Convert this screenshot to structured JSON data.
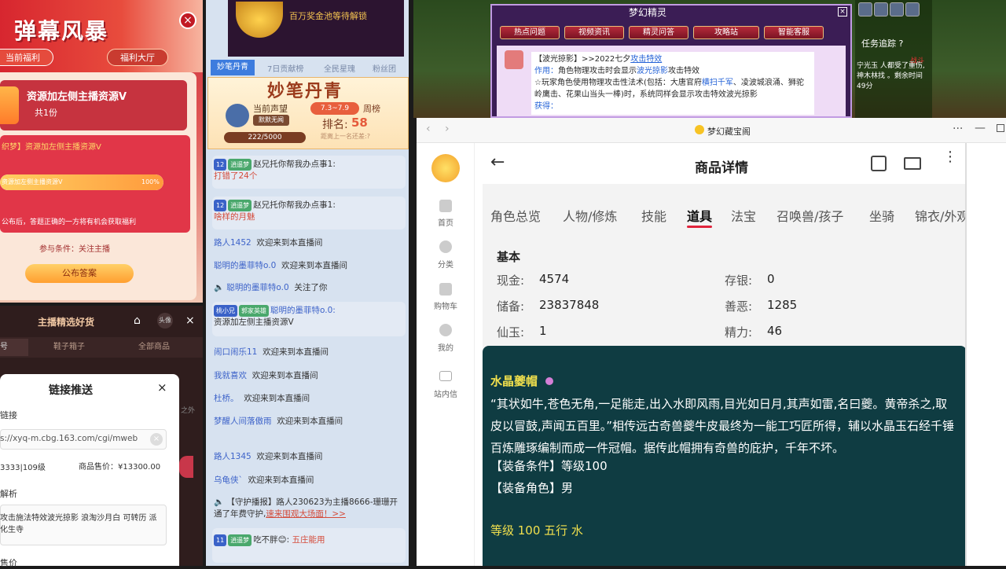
{
  "promo": {
    "title": "弹幕风暴",
    "close": "×",
    "tab_current": "当前福利",
    "tab_welfare": "福利大厅",
    "reward_name": "资源加左侧主播资源V",
    "reward_count": "共1份",
    "task_title": "织梦】资源加左侧主播资源V",
    "progress_text": "资源加左侧主播资源V",
    "progress_pct": "100%",
    "progress_value": 1.0,
    "task_note": "公布后，答题正确的一方将有机会获取福利",
    "condition": "参与条件：关注主播",
    "announce_button": "公布答案"
  },
  "shop": {
    "title": "主播精选好货",
    "home": "⌂",
    "avatar": "头像",
    "close": "×",
    "tabs": [
      "号",
      "鞋子箱子",
      "全部商品"
    ]
  },
  "dialog": {
    "title": "链接推送",
    "close": "×",
    "link_label": "链接",
    "link": "s://xyq-m.cbg.163.com/cgi/mweb",
    "clear": "×",
    "level": "3333|109级",
    "price": "商品售价：¥13300.00",
    "parse_label": "解析",
    "parse": "攻击施法特效波光掠影 浪淘沙月白 可转历 派化生寺",
    "price_label": "售价",
    "side_text": "之外"
  },
  "chat": {
    "top_text": "百万奖金池等待解锁",
    "tabs": [
      "妙笔丹青",
      "7日贡献榜",
      "全民星瑰",
      "粉丝团"
    ],
    "mb_title": "妙笔丹青",
    "voice_label": "当前声望",
    "streamer_name": "默默无闻",
    "score": "222/5000",
    "date_range": "7.3~7.9",
    "week_label": "周榜",
    "rank_label": "排名:",
    "rank": "58",
    "gap": "距离上一名还差:?",
    "messages": [
      {
        "badge": "12",
        "badge2": "逍遥梦",
        "text": "赵兄托你帮我办点事1:",
        "extra": "打错了24个",
        "extra_red": true
      },
      {
        "badge": "12",
        "badge2": "逍遥梦",
        "text": "赵兄托你帮我办点事1:",
        "extra": "啥样的月魅",
        "extra_red": true
      },
      {
        "nick": "路人1452",
        "text": "欢迎来到本直播间"
      },
      {
        "nick": "聪明的墨菲特o.0",
        "text": "欢迎来到本直播间"
      },
      {
        "nick": "聪明的墨菲特o.0",
        "text": "关注了你"
      },
      {
        "nick": "聪明的墨菲特o.0:",
        "badge": "桃小兄",
        "badge2": "郭家英雄",
        "text": "资源加左侧主播资源V"
      },
      {
        "nick": "闹口闹乐11",
        "text": "欢迎来到本直播间"
      },
      {
        "nick": "我就喜欢",
        "text": "欢迎来到本直播间"
      },
      {
        "nick": "杜桥。",
        "text": "欢迎来到本直播间"
      },
      {
        "nick": "梦醒人间落傲雨",
        "text": "欢迎来到本直播间"
      },
      {
        "nick": "路人1345",
        "text": "欢迎来到本直播间"
      },
      {
        "nick": "乌龟侠`",
        "text": "欢迎来到本直播间"
      },
      {
        "nick": "【守护播报】",
        "text": "路人230623为主播8666-珊珊开通了年费守护,",
        "link": "速来围观大场面！>>"
      },
      {
        "badge": "11",
        "badge2": "逍遥梦",
        "text": "吃不胖😊:",
        "extra": "五庄能用",
        "extra_red": true
      }
    ]
  },
  "game": {
    "mj_title": "梦幻精灵",
    "mj_close": "×",
    "buttons": [
      "热点问题",
      "视频资讯",
      "精灵问答",
      "攻略站",
      "智能客服"
    ],
    "content_1": "【波光掠影】>>2022七夕",
    "content_1_link": "攻击特效",
    "content_2_label": "作用：",
    "content_2": "角色物理攻击时会显示",
    "content_2_link": "波光掠影",
    "content_2_tail": "攻击特效",
    "content_3": "☆玩家角色使用物理攻击性法术(包括：大唐官府",
    "content_3_link": "横扫千军",
    "content_4": "、凌波城浪涌、狮驼岭鹰击、花果山当头一棒)时，系统同样会显示攻击特效波光掠影",
    "content_5": "获得：",
    "task_track": "任务追踪 ?",
    "task_fight": "战斗",
    "task_text": "宁光玉 人都受了重伤, 神木林找 。剩余时间49分"
  },
  "window": {
    "title": "梦幻藏宝阁",
    "back": "‹",
    "forward": "›",
    "more": "···",
    "minimize": "—"
  },
  "nav": [
    {
      "label": "首页"
    },
    {
      "label": "分类"
    },
    {
      "label": "购物车"
    },
    {
      "label": "我的"
    },
    {
      "label": "站内信"
    }
  ],
  "detail": {
    "back": "←",
    "title": "商品详情",
    "tabs": [
      "角色总览",
      "人物/修炼",
      "技能",
      "道具",
      "法宝",
      "召唤兽/孩子",
      "坐骑",
      "锦衣/外观"
    ],
    "active_tab": "道具",
    "section": "基本",
    "kv": [
      {
        "k": "现金:",
        "v": "4574"
      },
      {
        "k": "存银:",
        "v": "0"
      },
      {
        "k": "储备:",
        "v": "23837848"
      },
      {
        "k": "善恶:",
        "v": "1285"
      },
      {
        "k": "仙玉:",
        "v": "1"
      },
      {
        "k": "精力:",
        "v": "46"
      }
    ],
    "item_name": "水晶夔帽",
    "item_desc": "“其状如牛,苍色无角,一足能走,出入水即风雨,目光如日月,其声如雷,名曰夔。黄帝杀之,取皮以冒鼓,声闻五百里。”相传远古奇兽夔牛皮最终为一能工巧匠所得，辅以水晶玉石经千锤百炼雕琢编制而成一件冠帽。据传此帽拥有奇兽的庇护，千年不坏。",
    "item_cond": "【装备条件】等级100",
    "item_role": "【装备角色】男",
    "item_level": "等级 100 五行 水"
  }
}
